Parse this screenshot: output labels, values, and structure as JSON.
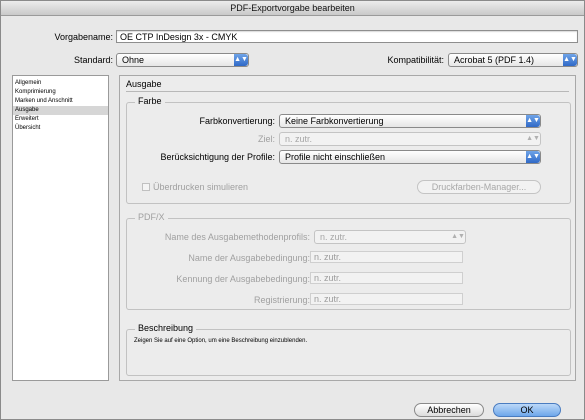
{
  "window": {
    "title": "PDF-Exportvorgabe bearbeiten"
  },
  "preset": {
    "name_label": "Vorgabename:",
    "name_value": "OE CTP InDesign 3x - CMYK"
  },
  "standard": {
    "label": "Standard:",
    "value": "Ohne"
  },
  "compatibility": {
    "label": "Kompatibilität:",
    "value": "Acrobat 5 (PDF 1.4)"
  },
  "sidebar": {
    "items": [
      {
        "label": "Allgemein"
      },
      {
        "label": "Komprimierung"
      },
      {
        "label": "Marken und Anschnitt"
      },
      {
        "label": "Ausgabe",
        "selected": true
      },
      {
        "label": "Erweitert"
      },
      {
        "label": "Übersicht"
      }
    ]
  },
  "panel": {
    "title": "Ausgabe"
  },
  "farbe": {
    "group_title": "Farbe",
    "conversion_label": "Farbkonvertierung:",
    "conversion_value": "Keine Farbkonvertierung",
    "target_label": "Ziel:",
    "target_value": "n. zutr.",
    "profiles_label": "Berücksichtigung der Profile:",
    "profiles_value": "Profile nicht einschließen",
    "overprint_label": "Überdrucken simulieren",
    "ink_manager_label": "Druckfarben-Manager..."
  },
  "pdfx": {
    "group_title": "PDF/X",
    "output_profile_label": "Name des Ausgabemethodenprofils:",
    "output_profile_value": "n. zutr.",
    "condition_name_label": "Name der Ausgabebedingung:",
    "condition_name_value": "n. zutr.",
    "condition_id_label": "Kennung der Ausgabebedingung:",
    "condition_id_value": "n. zutr.",
    "registry_label": "Registrierung:",
    "registry_value": "n. zutr."
  },
  "description": {
    "group_title": "Beschreibung",
    "text": "Zeigen Sie auf eine Option, um eine Beschreibung einzublenden."
  },
  "buttons": {
    "cancel": "Abbrechen",
    "ok": "OK"
  },
  "icons": {
    "popup_arrow": "updown-arrow-icon"
  },
  "colors": {
    "accent": "#3b78d6",
    "window_bg": "#e8e8e8"
  }
}
